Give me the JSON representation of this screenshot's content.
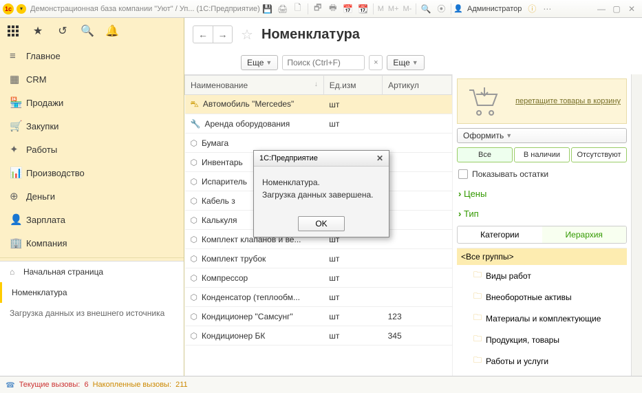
{
  "titlebar": {
    "title": "Демонстрационная база компании \"Уют\" / Уп... (1С:Предприятие)",
    "user": "Администратор"
  },
  "sidebar": {
    "items": [
      {
        "icon": "≡",
        "label": "Главное"
      },
      {
        "icon": "▦",
        "label": "CRM"
      },
      {
        "icon": "🏪",
        "label": "Продажи"
      },
      {
        "icon": "🛒",
        "label": "Закупки"
      },
      {
        "icon": "✦",
        "label": "Работы"
      },
      {
        "icon": "📊",
        "label": "Производство"
      },
      {
        "icon": "⊕",
        "label": "Деньги"
      },
      {
        "icon": "👤",
        "label": "Зарплата"
      },
      {
        "icon": "🏢",
        "label": "Компания"
      }
    ],
    "bottom": {
      "home": "Начальная страница",
      "current": "Номенклатура",
      "other": "Загрузка данных из внешнего источника"
    }
  },
  "content": {
    "title": "Номенклатура",
    "more_btn": "Еще",
    "search_placeholder": "Поиск (Ctrl+F)",
    "columns": {
      "name": "Наименование",
      "unit": "Ед.изм",
      "article": "Артикул"
    },
    "rows": [
      {
        "ico": "car",
        "name": "Автомобиль \"Mercedes\"",
        "unit": "шт",
        "article": "",
        "sel": true
      },
      {
        "ico": "wrench",
        "name": "Аренда оборудования",
        "unit": "шт",
        "article": ""
      },
      {
        "ico": "box",
        "name": "Бумага",
        "unit": "",
        "article": ""
      },
      {
        "ico": "box",
        "name": "Инвентарь",
        "unit": "",
        "article": ""
      },
      {
        "ico": "box",
        "name": "Испаритель",
        "unit": "",
        "article": ""
      },
      {
        "ico": "box",
        "name": "Кабель з",
        "unit": "",
        "article": ""
      },
      {
        "ico": "box",
        "name": "Калькуля",
        "unit": "",
        "article": ""
      },
      {
        "ico": "box",
        "name": "Комплект клапанов и ве...",
        "unit": "шт",
        "article": ""
      },
      {
        "ico": "box",
        "name": "Комплект трубок",
        "unit": "шт",
        "article": ""
      },
      {
        "ico": "box",
        "name": "Компрессор",
        "unit": "шт",
        "article": ""
      },
      {
        "ico": "box",
        "name": "Конденсатор (теплообм...",
        "unit": "шт",
        "article": ""
      },
      {
        "ico": "box",
        "name": "Кондиционер \"Самсунг\"",
        "unit": "шт",
        "article": "123"
      },
      {
        "ico": "box",
        "name": "Кондиционер БК",
        "unit": "шт",
        "article": "345"
      }
    ]
  },
  "rpanel": {
    "cart_hint": "перетащите товары в корзину",
    "oformit": "Оформить",
    "filters": [
      "Все",
      "В наличии",
      "Отсутствуют"
    ],
    "show_stock": "Показывать остатки",
    "expanders": [
      "Цены",
      "Тип"
    ],
    "tabs": [
      "Категории",
      "Иерархия"
    ],
    "tree": {
      "root": "<Все группы>",
      "children": [
        "Виды работ",
        "Внеоборотные активы",
        "Материалы и комплектующие",
        "Продукция, товары",
        "Работы и услуги"
      ]
    }
  },
  "dialog": {
    "title": "1С:Предприятие",
    "line1": "Номенклатура.",
    "line2": "Загрузка данных завершена.",
    "ok": "OK"
  },
  "statusbar": {
    "calls_label": "Текущие вызовы:",
    "calls_val": "6",
    "accum_label": "Накопленные вызовы:",
    "accum_val": "211"
  }
}
